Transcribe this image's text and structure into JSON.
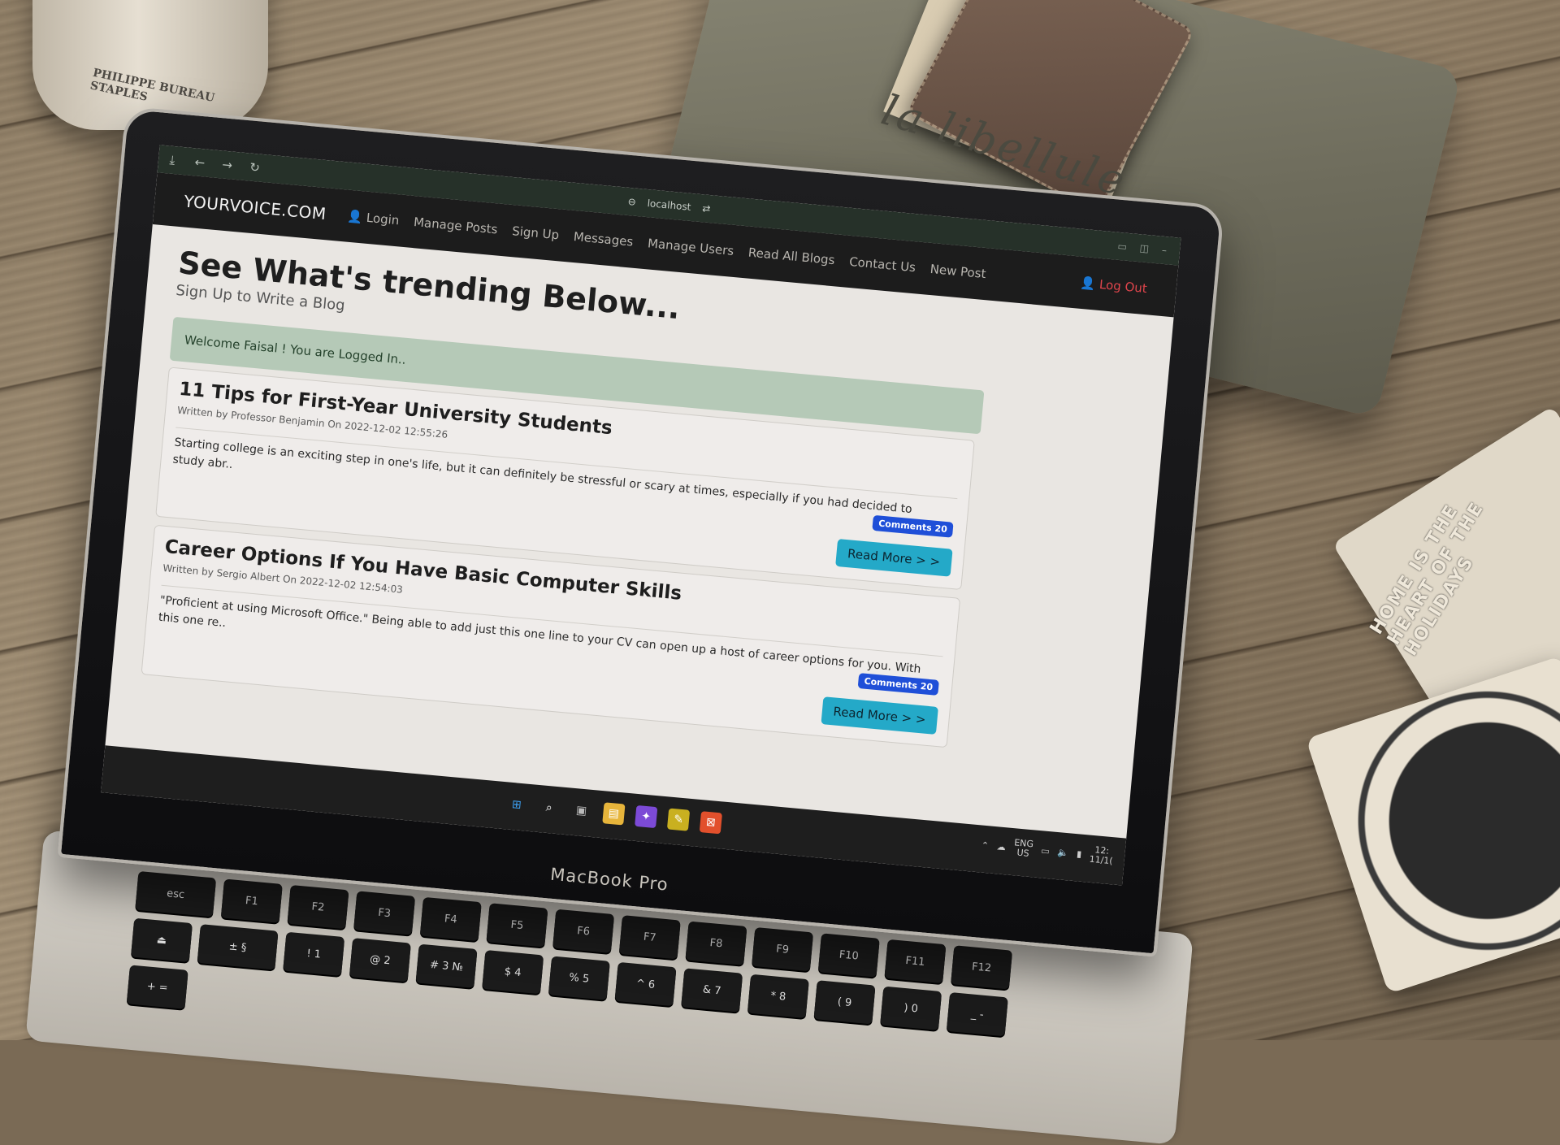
{
  "scene": {
    "jar_label": "PHILIPPE BUREAU STAPLES",
    "pouch_text": "la libellule",
    "coaster_text": "HOME IS THE HEART OF THE HOLIDAYS",
    "laptop_label": "MacBook Pro"
  },
  "browser": {
    "url": "localhost",
    "icons": [
      "download-icon",
      "back-icon",
      "forward-icon",
      "reload-icon"
    ]
  },
  "site": {
    "brand": "YOURVOICE.COM",
    "nav": [
      {
        "label": "Login",
        "icon": "user-icon"
      },
      {
        "label": "Manage Posts"
      },
      {
        "label": "Sign Up"
      },
      {
        "label": "Messages"
      },
      {
        "label": "Manage Users"
      },
      {
        "label": "Read All Blogs"
      },
      {
        "label": "Contact Us"
      },
      {
        "label": "New Post"
      }
    ],
    "logout": "Log Out"
  },
  "hero": {
    "title": "See What's trending Below...",
    "subtitle": "Sign Up to Write a Blog"
  },
  "alert": "Welcome Faisal ! You are Logged In..",
  "posts": [
    {
      "title": "11 Tips for First-Year University Students",
      "meta": "Written by Professor Benjamin On 2022-12-02 12:55:26",
      "badge": "Comments 20",
      "body": "Starting college is an exciting step in one's life, but it can definitely be stressful or scary at times, especially if you had decided to study abr..",
      "read_more": "Read More > >"
    },
    {
      "title": "Career Options If You Have Basic Computer Skills",
      "meta": "Written by Sergio Albert On 2022-12-02 12:54:03",
      "badge": "Comments 20",
      "body": "\"Proficient at using Microsoft Office.\" Being able to add just this one line to your CV can open up a host of career options for you. With this one re..",
      "read_more": "Read More > >"
    }
  ],
  "taskbar": {
    "lang_top": "ENG",
    "lang_bottom": "US",
    "time": "12:",
    "date": "11/1("
  },
  "keyboard": [
    "esc",
    "F1",
    "F2",
    "F3",
    "F4",
    "F5",
    "F6",
    "F7",
    "F8",
    "F9",
    "F10",
    "F11",
    "F12",
    "⏏",
    "± §",
    "! 1",
    "@ 2",
    "# 3 №",
    "$ 4",
    "% 5",
    "^ 6",
    "& 7",
    "* 8",
    "( 9",
    ") 0",
    "_ -",
    "+ ="
  ]
}
